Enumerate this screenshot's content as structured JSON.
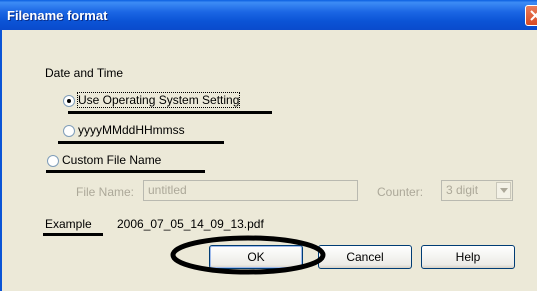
{
  "window": {
    "title": "Filename format"
  },
  "date_time": {
    "heading": "Date and Time",
    "option_os": "Use Operating System Setting",
    "option_format": "yyyyMMddHHmmss",
    "selected": "Use Operating System Setting"
  },
  "custom": {
    "option_label": "Custom File Name",
    "file_name_label": "File Name:",
    "file_name_value": "untitled",
    "counter_label": "Counter:",
    "counter_value": "3 digit"
  },
  "example": {
    "label": "Example",
    "value": "2006_07_05_14_09_13.pdf"
  },
  "buttons": {
    "ok": "OK",
    "cancel": "Cancel",
    "help": "Help"
  },
  "colors": {
    "titlebar": "#0b54d6",
    "dialog_bg": "#ece9d8",
    "radio_dot": "#21a121",
    "annotation": "#000000"
  }
}
